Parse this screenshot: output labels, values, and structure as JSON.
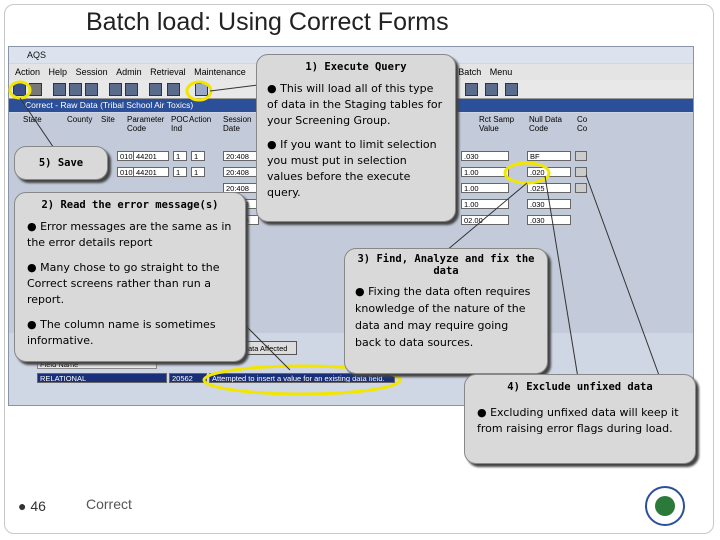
{
  "slide": {
    "title": "Batch load: Using Correct Forms",
    "page_number": "46",
    "footer_text": "Correct"
  },
  "app": {
    "window_title": "AQS",
    "menu": [
      "Action",
      "Help",
      "Session",
      "Admin",
      "Retrieval",
      "Maintenance",
      "Batch",
      "Menu"
    ],
    "form_title": "Correct - Raw Data (Tribal School Air Toxics)",
    "columns": [
      {
        "label": "State"
      },
      {
        "label": "County"
      },
      {
        "label": "Site"
      },
      {
        "label": "Parameter Code"
      },
      {
        "label": "POC Ind"
      },
      {
        "label": "Action"
      },
      {
        "label": "Session Date"
      },
      {
        "label": "Rct Samp Value"
      },
      {
        "label": "Null Data Code"
      },
      {
        "label": "Co Co"
      }
    ],
    "rows": [
      {
        "site": "010",
        "param": "44201",
        "poc": "1",
        "ind": "1",
        "date": "20:408",
        "value": ".030",
        "null_code": "BF"
      },
      {
        "site": "010",
        "param": "44201",
        "poc": "1",
        "ind": "1",
        "date": "20:408",
        "value": "1.00",
        "null_code": ".020"
      },
      {
        "site": "",
        "param": "",
        "poc": "",
        "ind": "",
        "date": "20:408",
        "value": "1.00",
        "null_code": ".025"
      },
      {
        "site": "",
        "param": "",
        "poc": "",
        "ind": "",
        "date": "20:408",
        "value": "1.00",
        "null_code": ".030"
      },
      {
        "site": "",
        "param": "",
        "poc": "",
        "ind": "",
        "date": "20:408",
        "value": "02.00",
        "null_code": ".030"
      }
    ],
    "data_affected_button": "Data Affected",
    "error_header": "Field Name",
    "error_row": {
      "field": "RELATIONAL",
      "code": "20562",
      "message": "Attempted to insert a value for an existing data field."
    }
  },
  "callouts": {
    "execute_query": {
      "heading": "1) Execute Query",
      "bullets": [
        "This will load all of this type of data in the Staging tables for your Screening Group.",
        "If you want to limit selection you must put in selection values before the execute query."
      ]
    },
    "save": {
      "heading": "5) Save"
    },
    "read_errors": {
      "heading": "2) Read the error message(s)",
      "bullets": [
        "Error messages are the same as in the error details report",
        "Many chose to go straight to the Correct screens rather than run a report.",
        "The column name is sometimes informative."
      ]
    },
    "find_fix": {
      "heading": "3) Find, Analyze and fix the data",
      "bullets": [
        "Fixing the data often requires knowledge of the nature of the data and may require going back to data sources."
      ]
    },
    "exclude": {
      "heading": "4) Exclude unfixed data",
      "bullets": [
        "Excluding unfixed data will keep it from raising error flags during load."
      ]
    }
  },
  "icons": [
    "save-icon",
    "print-icon",
    "execute-query-icon",
    "epa-seal-icon"
  ],
  "colors": {
    "callout_bg": "#d9d9d9",
    "highlight": "#f2e600",
    "form_title_bg": "#2c4f9a"
  }
}
